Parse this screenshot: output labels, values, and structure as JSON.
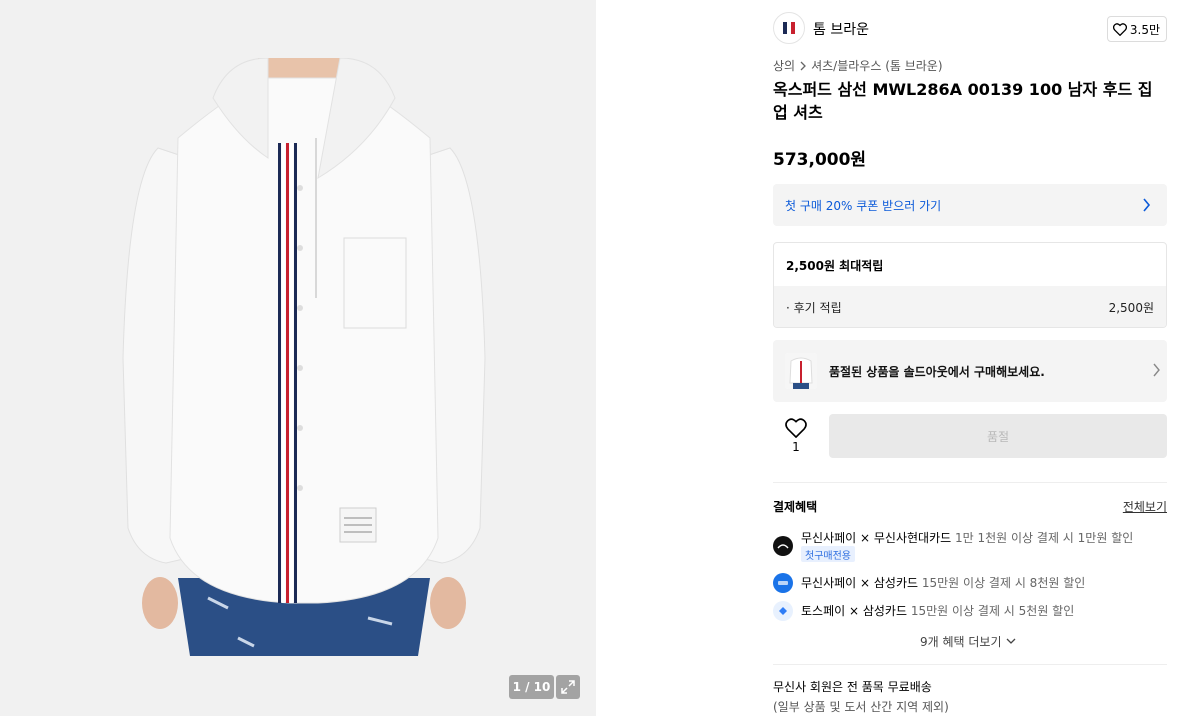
{
  "gallery": {
    "counter": "1 / 10"
  },
  "brand": {
    "name": "톰 브라운",
    "likes": "3.5만"
  },
  "breadcrumb": {
    "level1": "상의",
    "level2": "셔츠/블라우스 (톰 브라운)"
  },
  "product": {
    "title": "옥스퍼드 삼선 MWL286A 00139 100 남자 후드 집업 셔츠",
    "price": "573,000원"
  },
  "coupon": {
    "label": "첫 구매 20% 쿠폰 받으러 가기"
  },
  "points": {
    "header": "2,500원 최대적립",
    "review_label": "· 후기 적립",
    "review_value": "2,500원"
  },
  "soldout_banner": {
    "text": "품절된 상품을 솔드아웃에서 구매해보세요."
  },
  "wishlist": {
    "count": "1"
  },
  "buy_button": {
    "label": "품절"
  },
  "payment": {
    "title": "결제혜택",
    "see_all": "전체보기",
    "benefits": [
      {
        "name": "무신사페이 × 무신사현대카드",
        "desc": "1만 1천원 이상 결제 시 1만원 할인",
        "tag": "첫구매전용"
      },
      {
        "name": "무신사페이 × 삼성카드",
        "desc": "15만원 이상 결제 시 8천원 할인"
      },
      {
        "name": "토스페이 × 삼성카드",
        "desc": "15만원 이상 결제 시 5천원 할인"
      }
    ],
    "more": "9개 혜택 더보기"
  },
  "shipping": {
    "line1": "무신사 회원은 전 품목 무료배송",
    "line2": "(일부 상품 및 도서 산간 지역 제외)"
  },
  "colors": {
    "accent_blue": "#0b5ad9",
    "panel_bg": "#f4f4f4",
    "gallery_bg": "#f1f1f1"
  }
}
